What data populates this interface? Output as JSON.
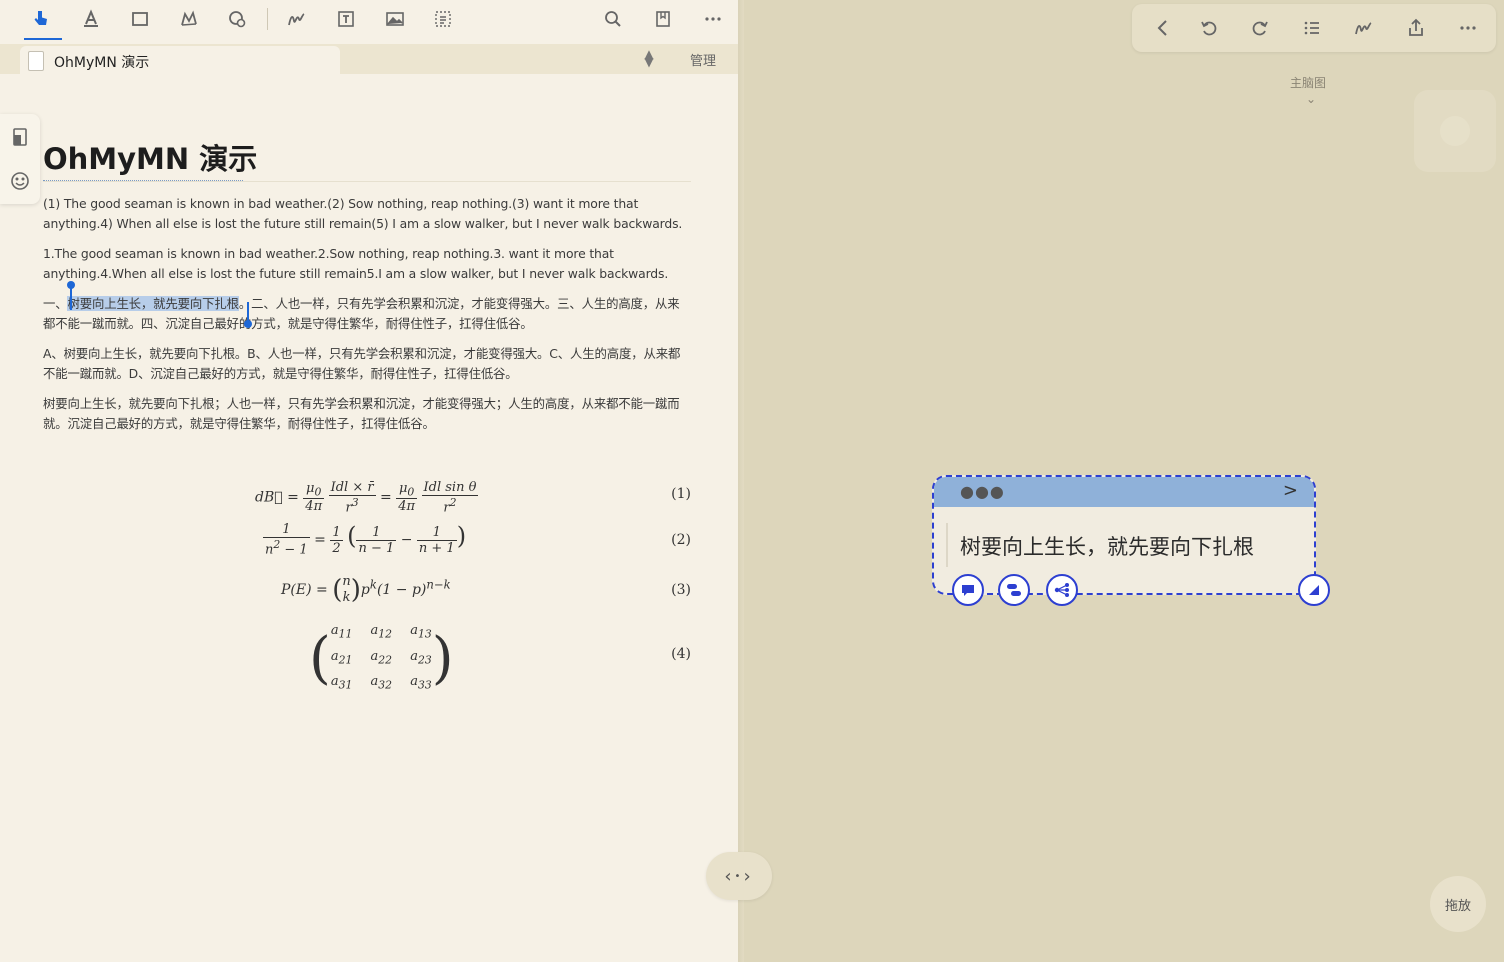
{
  "toolbar": {
    "icons": [
      "hand-pointer-icon",
      "text-highlight-icon",
      "rect-select-icon",
      "lasso-icon",
      "shape-gear-icon",
      "pen-icon",
      "textbox-icon",
      "image-icon",
      "ocr-icon",
      "search-icon",
      "bookmark-icon",
      "more-icon"
    ]
  },
  "tab": {
    "title": "OhMyMN 演示",
    "manage": "管理"
  },
  "doc": {
    "title": "OhMyMN 演示",
    "p1": "(1) The good seaman is known in bad weather.(2) Sow nothing, reap nothing.(3) want it more that anything.4) When all else is lost the future still remain(5) I am a slow walker, but I never walk backwards.",
    "p2": "1.The good seaman is known in bad weather.2.Sow nothing, reap nothing.3. want it more that anything.4.When all else is lost the future still remain5.I am a slow walker, but I never walk backwards.",
    "p3_prefix": "一、",
    "p3_highlight": "树要向上生长，就先要向下扎根",
    "p3_rest": "。二、人也一样，只有先学会积累和沉淀，才能变得强大。三、人生的高度，从来都不能一蹴而就。四、沉淀自己最好的方式，就是守得住繁华，耐得住性子，扛得住低谷。",
    "p4": "A、树要向上生长，就先要向下扎根。B、人也一样，只有先学会积累和沉淀，才能变得强大。C、人生的高度，从来都不能一蹴而就。D、沉淀自己最好的方式，就是守得住繁华，耐得住性子，扛得住低谷。",
    "p5": "树要向上生长，就先要向下扎根；人也一样，只有先学会积累和沉淀，才能变得强大；人生的高度，从来都不能一蹴而就。沉淀自己最好的方式，就是守得住繁华，耐得住性子，扛得住低谷。",
    "eq_nums": [
      "(1)",
      "(2)",
      "(3)",
      "(4)"
    ]
  },
  "right": {
    "mindmap_label": "主脑图",
    "card_text": "树要向上生长，就先要向下扎根",
    "drag_label": "拖放"
  },
  "colors": {
    "accent": "#1e67d6",
    "card_border": "#2d3fd1",
    "card_header": "#8fb1d9",
    "highlight": "#b7cde9"
  }
}
